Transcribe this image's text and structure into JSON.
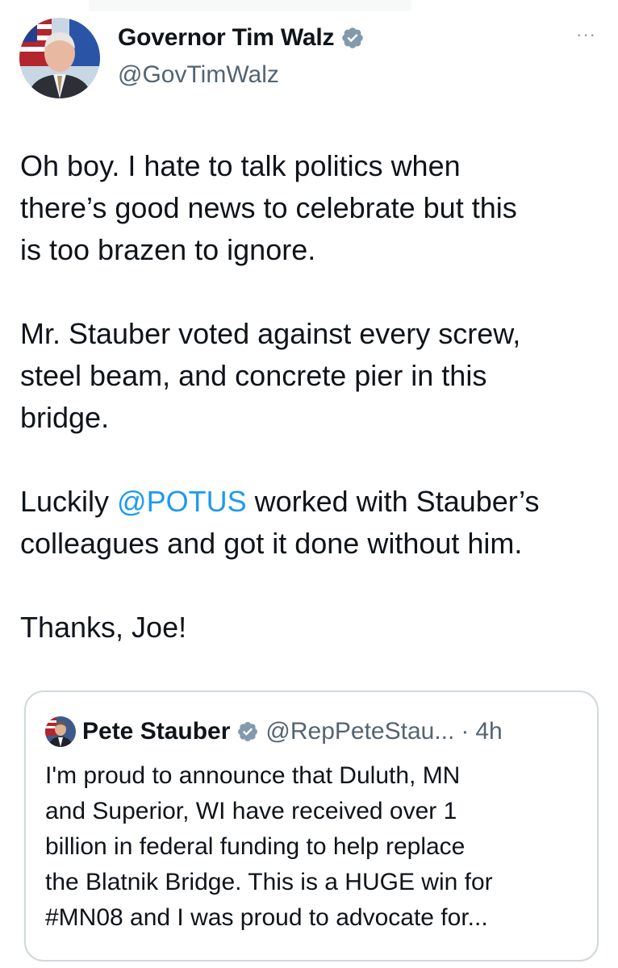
{
  "tweet": {
    "author": {
      "display_name": "Governor Tim Walz",
      "handle": "@GovTimWalz",
      "avatar_icon": "person-avatar-icon",
      "verified_icon": "verified-badge-icon"
    },
    "more_label": "···",
    "paragraphs": {
      "p1": "Oh boy. I hate to talk politics when\nthere’s good news to celebrate but this\nis too brazen to ignore.",
      "p2": "Mr. Stauber voted against every screw,\nsteel beam, and concrete pier in this\nbridge.",
      "p3_before": "Luckily ",
      "p3_mention": "@POTUS",
      "p3_after": " worked with Stauber’s\ncolleagues and got it done without him.",
      "p4": "Thanks, Joe!"
    }
  },
  "quoted_tweet": {
    "author": {
      "display_name": "Pete Stauber",
      "handle": "@RepPeteStau...",
      "separator": "·",
      "time": "4h"
    },
    "text": "I'm proud to announce that Duluth, MN\nand Superior, WI have received over 1\nbillion in federal funding to help replace\nthe Blatnik Bridge. This is a HUGE win for\n#MN08 and I was proud to advocate for..."
  },
  "colors": {
    "text": "#0f1419",
    "secondary": "#536471",
    "mention": "#1d9bf0",
    "verified": "#829aab",
    "border": "#cfd9de"
  }
}
